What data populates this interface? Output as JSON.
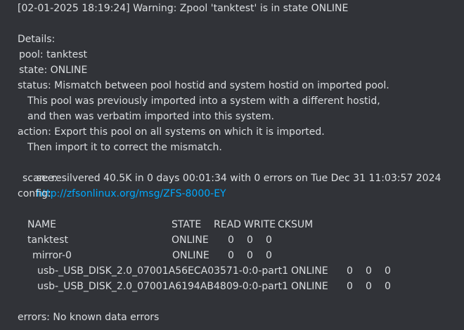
{
  "message": {
    "header": "[02-01-2025 18:19:24] Warning: Zpool 'tanktest' is in state ONLINE",
    "details_label": "Details:",
    "pool_line": "pool: tanktest",
    "state_line": "state: ONLINE",
    "status_line1": "status: Mismatch between pool hostid and system hostid on imported pool.",
    "status_line2": "This pool was previously imported into a system with a different hostid,",
    "status_line3": "and then was verbatim imported into this system.",
    "action_line1": "action: Export this pool on all systems on which it is imported.",
    "action_line2": "Then import it to correct the mismatch.",
    "see_label": "see:",
    "see_url": "http://zfsonlinux.org/msg/ZFS-8000-EY",
    "scan_line": "scan: resilvered 40.5K in 0 days 00:01:34 with 0 errors on Tue Dec 31 11:03:57 2024",
    "config_label": "config:",
    "errors_line": "errors: No known data errors"
  },
  "config_table": {
    "headers": {
      "name": "NAME",
      "state": "STATE",
      "read": "READ",
      "write": "WRITE",
      "cksum": "CKSUM"
    },
    "rows": [
      {
        "name": "tanktest",
        "state": "ONLINE",
        "read": "0",
        "write": "0",
        "cksum": "0"
      },
      {
        "name": "mirror-0",
        "state": "ONLINE",
        "read": "0",
        "write": "0",
        "cksum": "0"
      },
      {
        "name": "usb-_USB_DISK_2.0_07001A56ECA03571-0:0-part1",
        "state": "ONLINE",
        "read": "0",
        "write": "0",
        "cksum": "0"
      },
      {
        "name": "usb-_USB_DISK_2.0_07001A6194AB4809-0:0-part1",
        "state": "ONLINE",
        "read": "0",
        "write": "0",
        "cksum": "0"
      }
    ]
  },
  "colors": {
    "background": "#313338",
    "text": "#dbdee1",
    "link": "#00a8fc"
  }
}
